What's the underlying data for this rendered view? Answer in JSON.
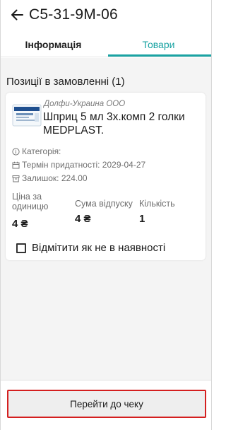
{
  "header": {
    "title": "С5-31-9М-06",
    "back_icon": "arrow-left-icon"
  },
  "tabs": [
    {
      "label": "Інформація",
      "active": false
    },
    {
      "label": "Товари",
      "active": true
    }
  ],
  "order": {
    "section_title": "Позиції в замовленні (1)",
    "items": [
      {
        "supplier": "Долфи-Украина ООО",
        "product_name": "Шприц 5 мл 3х.комп 2 голки MEDPLAST.",
        "category_label": "Категорія:",
        "expiry_label": "Термін придатності: 2029-04-27",
        "stock_label": "Залишок: 224.00",
        "price_label": "Ціна за одиницю",
        "price_value": "4 ₴",
        "sum_label": "Сума відпуску",
        "sum_value": "4 ₴",
        "qty_label": "Кількість",
        "qty_value": "1",
        "unavailable_label": "Відмітити як не в наявності",
        "unavailable_checked": false
      }
    ]
  },
  "footer": {
    "cta_label": "Перейти до чеку"
  },
  "colors": {
    "accent": "#1aa3a3",
    "highlight": "#d41f1f",
    "background": "#f4f4f4"
  }
}
